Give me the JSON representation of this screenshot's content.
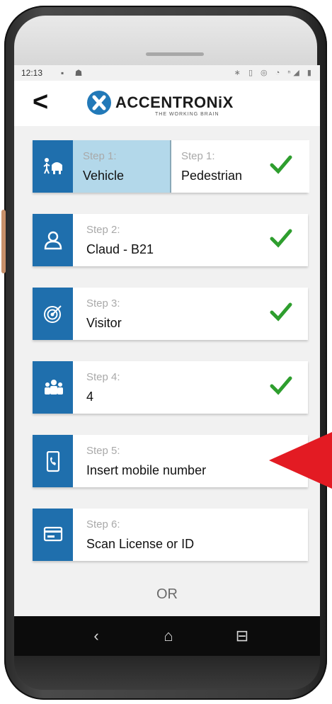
{
  "status_bar": {
    "time": "12:13",
    "left_icons": "▪ ☗",
    "right_icons": "∗ ▯ ◎ ◔ ⁿ◢ ▮"
  },
  "header": {
    "back_glyph": "<",
    "logo_text": "ACCENTRONiX",
    "logo_tagline": "THE WORKING BRAIN"
  },
  "steps": [
    {
      "icon": "pedestrian-vehicle-icon",
      "options": [
        {
          "label": "Step 1:",
          "value": "Vehicle",
          "selected": true
        },
        {
          "label": "Step 1:",
          "value": "Pedestrian",
          "selected": false
        }
      ],
      "completed": true
    },
    {
      "icon": "user-icon",
      "label": "Step 2:",
      "value": "Claud - B21",
      "completed": true
    },
    {
      "icon": "target-icon",
      "label": "Step 3:",
      "value": "Visitor",
      "completed": true
    },
    {
      "icon": "group-icon",
      "label": "Step 4:",
      "value": "4",
      "completed": true
    },
    {
      "icon": "mobile-phone-icon",
      "label": "Step 5:",
      "value": "Insert mobile number",
      "completed": false
    },
    {
      "icon": "id-card-icon",
      "label": "Step 6:",
      "value": "Scan License or ID",
      "completed": false
    }
  ],
  "or_text": "OR",
  "navbar": {
    "back_glyph": "‹",
    "home_glyph": "⌂",
    "recents_glyph": "⊟"
  },
  "colors": {
    "accent": "#1f6fad",
    "selected_bg": "#b3d8ea",
    "check": "#2e9e2e",
    "pointer_arrow": "#e31b23"
  }
}
